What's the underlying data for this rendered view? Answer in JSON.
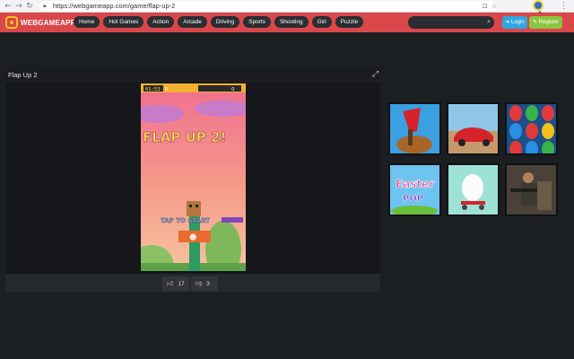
{
  "browser": {
    "url": "https://webgameapp.com/game/flap-up-2",
    "nav_icons": [
      "back-arrow-icon",
      "forward-arrow-icon",
      "reload-icon"
    ],
    "security_icon": "lock-icon"
  },
  "header": {
    "logo_text": "WEBGAMEAPP",
    "nav_items": [
      "Home",
      "Hot Games",
      "Action",
      "Arcade",
      "Driving",
      "Sports",
      "Shooting",
      "Girl",
      "Puzzle"
    ],
    "search_placeholder": "",
    "login_label": "Login",
    "register_label": "Register",
    "colors": {
      "header_bg": "#d9474a",
      "login": "#2fa6de",
      "register": "#8bc53f"
    }
  },
  "game": {
    "title": "Flap Up 2",
    "canvas": {
      "game_logo": "FLAP UP 2!",
      "hud_left": "01:53",
      "hud_left_count": "0",
      "hud_right_count": "0",
      "hint_text": "TAP TO START"
    },
    "likes": "17",
    "dislikes": "3"
  },
  "related_games": [
    {
      "name": "axe-chop-game-thumbnail"
    },
    {
      "name": "red-car-racing-game-thumbnail"
    },
    {
      "name": "colorful-eggs-game-thumbnail"
    },
    {
      "name": "easter-pop-game-thumbnail",
      "text_line1": "Easter",
      "text_line2": "POP"
    },
    {
      "name": "egg-on-cart-game-thumbnail"
    },
    {
      "name": "soldier-shooter-game-thumbnail"
    }
  ]
}
